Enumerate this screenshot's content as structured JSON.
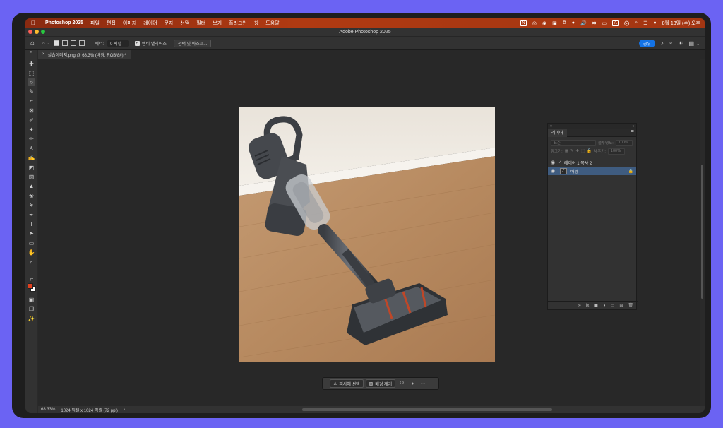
{
  "menubar": {
    "app_name": "Photoshop 2025",
    "items": [
      "파일",
      "편집",
      "이미지",
      "레이어",
      "문자",
      "선택",
      "필터",
      "보기",
      "플러그인",
      "창",
      "도움말"
    ],
    "datetime": "8월 13일 (수) 오후",
    "input_badge": "A",
    "n_badge": "N"
  },
  "titlebar": {
    "title": "Adobe Photoshop 2025"
  },
  "options": {
    "feather_label": "페더:",
    "feather_value": "0 픽셀",
    "antialias_label": "앤티 앨리어스",
    "select_mask_label": "선택 및 마스크...",
    "share_label": "공유"
  },
  "document": {
    "tab_label": "실습이미지.png @ 68.3% (배경, RGB/8#) *",
    "close_glyph": "×"
  },
  "status": {
    "zoom": "68.33%",
    "doc_info": "1024 픽셀 x 1024 픽셀 (72 ppi)",
    "arrow": "›"
  },
  "context_bar": {
    "select_subject": "피사체 선택",
    "remove_bg": "배경 제거",
    "more": "···"
  },
  "layers_panel": {
    "tab_label": "레이어",
    "blend_mode": "표준",
    "opacity_label": "불투명도:",
    "opacity_value": "100%",
    "lock_label": "잠그기:",
    "fill_label": "채우기:",
    "fill_value": "100%",
    "layers": [
      {
        "name": "레이어 1 복사 2",
        "selected": false
      },
      {
        "name": "배경",
        "selected": true
      }
    ]
  },
  "colors": {
    "foreground": "#e0401f",
    "background": "#ffffff",
    "accent": "#1473e6",
    "menubar": "#a33612"
  }
}
